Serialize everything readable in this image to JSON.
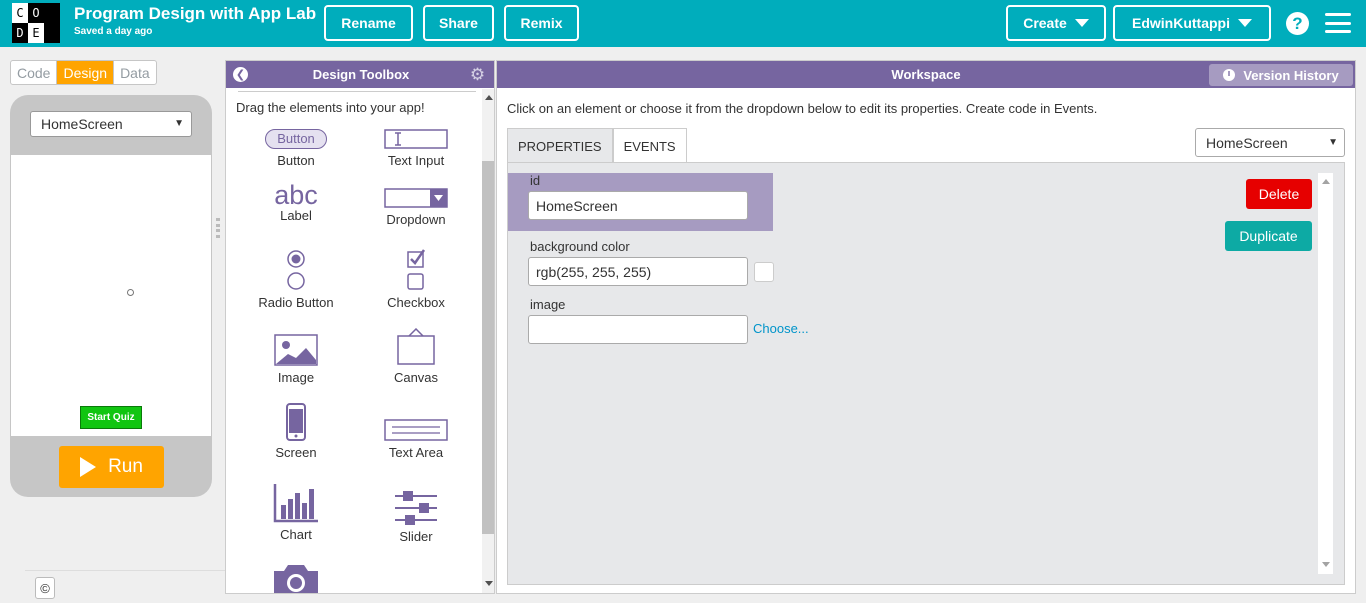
{
  "header": {
    "logo_letters": [
      "C",
      "O",
      "D",
      "E"
    ],
    "title": "Program Design with App Lab",
    "saved": "Saved a day ago",
    "rename_label": "Rename",
    "share_label": "Share",
    "remix_label": "Remix",
    "create_label": "Create",
    "user_label": "EdwinKuttappi",
    "help_glyph": "?",
    "accent_color": "#00adbc"
  },
  "mode_tabs": [
    "Code",
    "Design",
    "Data"
  ],
  "phone": {
    "screen_select": "HomeScreen",
    "start_quiz_label": "Start Quiz",
    "run_label": "Run",
    "copyright_glyph": "©"
  },
  "toolbox": {
    "title": "Design Toolbox",
    "instructions": "Drag the elements into your app!",
    "button_preview": "Button",
    "items": [
      {
        "label": "Button",
        "icon": "button-icon"
      },
      {
        "label": "Text Input",
        "icon": "text-input-icon"
      },
      {
        "label": "Label",
        "icon": "label-icon",
        "preview": "abc"
      },
      {
        "label": "Dropdown",
        "icon": "dropdown-icon"
      },
      {
        "label": "Radio Button",
        "icon": "radio-icon"
      },
      {
        "label": "Checkbox",
        "icon": "checkbox-icon"
      },
      {
        "label": "Image",
        "icon": "image-icon"
      },
      {
        "label": "Canvas",
        "icon": "canvas-icon"
      },
      {
        "label": "Screen",
        "icon": "screen-icon"
      },
      {
        "label": "Text Area",
        "icon": "text-area-icon"
      },
      {
        "label": "Chart",
        "icon": "chart-icon"
      },
      {
        "label": "Slider",
        "icon": "slider-icon"
      },
      {
        "label": "",
        "icon": "camera-icon"
      }
    ]
  },
  "workspace": {
    "title": "Workspace",
    "version_history_label": "Version History",
    "instructions": "Click on an element or choose it from the dropdown below to edit its properties. Create code in Events.",
    "tabs": [
      "PROPERTIES",
      "EVENTS"
    ],
    "element_select": "HomeScreen",
    "properties": {
      "id_label": "id",
      "id_value": "HomeScreen",
      "bg_label": "background color",
      "bg_value": "rgb(255, 255, 255)",
      "image_label": "image",
      "image_value": "",
      "choose_label": "Choose..."
    },
    "delete_label": "Delete",
    "duplicate_label": "Duplicate"
  }
}
